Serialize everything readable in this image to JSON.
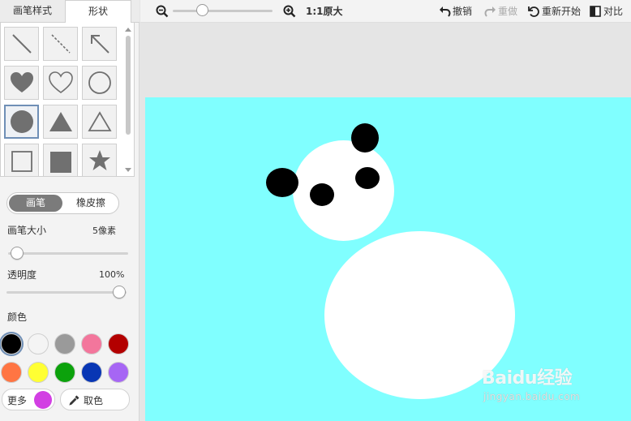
{
  "tabs": {
    "brush_style": "画笔样式",
    "shape": "形状"
  },
  "shapes": [
    "line",
    "dashed-line",
    "arrow",
    "heart-filled",
    "heart-outline",
    "circle-outline",
    "circle-filled",
    "triangle-filled",
    "triangle-outline",
    "square-outline",
    "square-filled",
    "star-filled"
  ],
  "selected_shape": "circle-filled",
  "mode_toggle": {
    "brush": "画笔",
    "eraser": "橡皮擦"
  },
  "brush_size": {
    "label": "画笔大小",
    "value": "5像素"
  },
  "opacity": {
    "label": "透明度",
    "value": "100%"
  },
  "color_section": {
    "label": "颜色"
  },
  "palette": [
    "#000000",
    "#f4f4f4",
    "#9a9a9a",
    "#f3769c",
    "#b30000",
    "#ff7543",
    "#ffff33",
    "#0ca20c",
    "#0836b4",
    "#a666f4"
  ],
  "selected_color": "#000000",
  "more": {
    "label": "更多",
    "color": "#d23fe3"
  },
  "picker": {
    "label": "取色"
  },
  "toolbar": {
    "zoom_level": "1:1原大",
    "undo": "撤销",
    "redo": "重做",
    "restart": "重新开始",
    "compare": "对比"
  },
  "canvas": {
    "background": "#80ffff",
    "shapes": [
      {
        "type": "ellipse",
        "color": "#ffffff",
        "name": "body"
      },
      {
        "type": "ellipse",
        "color": "#ffffff",
        "name": "head"
      },
      {
        "type": "ellipse",
        "color": "#000000",
        "name": "ear-top"
      },
      {
        "type": "ellipse",
        "color": "#000000",
        "name": "ear-left"
      },
      {
        "type": "ellipse",
        "color": "#000000",
        "name": "eye-right"
      },
      {
        "type": "ellipse",
        "color": "#000000",
        "name": "eye-left"
      }
    ]
  },
  "watermark": {
    "logo": "Baidu经验",
    "url": "jingyan.baidu.com"
  }
}
